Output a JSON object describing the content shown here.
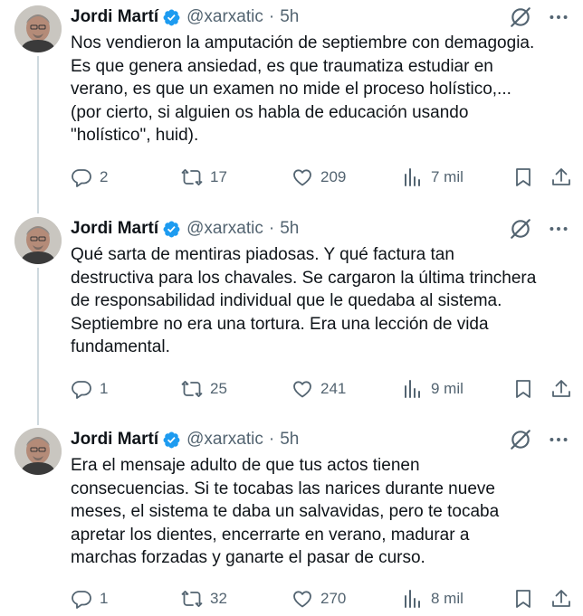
{
  "colors": {
    "verified": "#1d9bf0",
    "secondary": "#536471",
    "text": "#0f1419"
  },
  "tweets": [
    {
      "author": "Jordi Martí",
      "handle": "@xarxatic",
      "sep": "·",
      "time": "5h",
      "text": "Nos vendieron la amputación de septiembre con demagogia.\nEs que genera ansiedad, es que traumatiza estudiar en\nverano, es que un examen no mide el proceso holístico,...\n(por cierto, si alguien os habla de educación usando\n\"holístico\", huid).",
      "replies": "2",
      "reposts": "17",
      "likes": "209",
      "views": "7 mil"
    },
    {
      "author": "Jordi Martí",
      "handle": "@xarxatic",
      "sep": "·",
      "time": "5h",
      "text": "Qué sarta de mentiras piadosas. Y qué factura tan\ndestructiva para los chavales. Se cargaron la última trinchera\nde responsabilidad individual que le quedaba al sistema.\nSeptiembre no era una tortura. Era una lección de vida\nfundamental.",
      "replies": "1",
      "reposts": "25",
      "likes": "241",
      "views": "9 mil"
    },
    {
      "author": "Jordi Martí",
      "handle": "@xarxatic",
      "sep": "·",
      "time": "5h",
      "text": "Era el mensaje adulto de que tus actos tienen\nconsecuencias. Si te tocabas las narices durante nueve\nmeses, el sistema te daba un salvavidas, pero te tocaba\napretar los dientes, encerrarte en verano, madurar a\nmarchas forzadas y ganarte el pasar de curso.",
      "replies": "1",
      "reposts": "32",
      "likes": "270",
      "views": "8 mil"
    }
  ]
}
